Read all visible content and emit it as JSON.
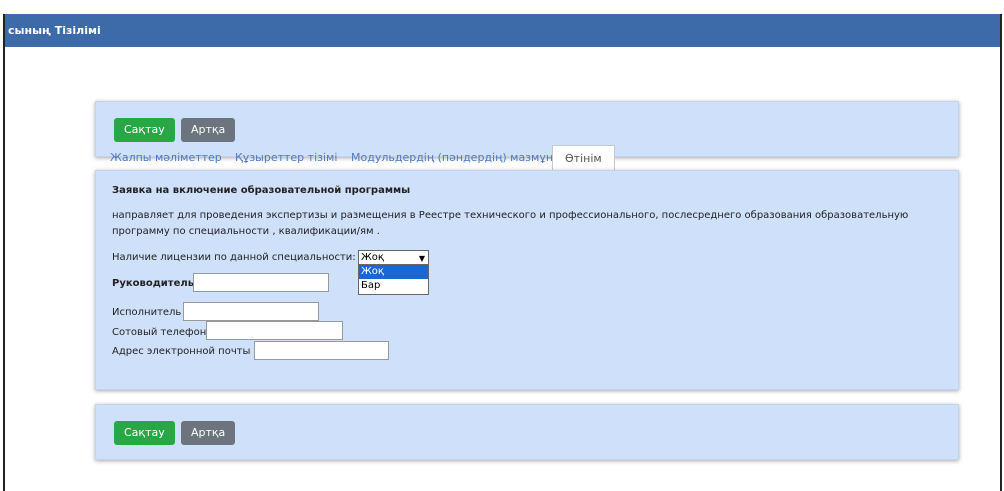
{
  "window": {
    "title": "сының Тізілімі"
  },
  "toolbar_top": {
    "save_label": "Сақтау",
    "back_label": "Артқа"
  },
  "toolbar_bottom": {
    "save_label": "Сақтау",
    "back_label": "Артқа"
  },
  "tabs": [
    {
      "label": "Жалпы мәліметтер"
    },
    {
      "label": "Құзыреттер тізімі"
    },
    {
      "label": "Модульдердің (пәндердің) мазмұны"
    },
    {
      "label": "Өтінім"
    }
  ],
  "form": {
    "heading": "Заявка на включение образовательной программы",
    "description_line1": "направляет для проведения экспертизы и размещения в Реестре технического и профессионального, послесреднего образования образовательную",
    "description_line2": "программу по специальности , квалификации/ям .",
    "license_label": "Наличие лицензии по данной специальности:",
    "license_value": "Жоқ",
    "license_options": [
      "Жоқ",
      "Бар"
    ],
    "manager_label": "Руководитель",
    "manager_value": "",
    "executor_label": "Исполнитель",
    "executor_value": "",
    "phone_label": "Сотовый телефон",
    "phone_value": "",
    "email_label": "Адрес электронной почты",
    "email_value": ""
  },
  "colors": {
    "titlebar": "#3d6aa8",
    "panel": "#cfe0fb",
    "save": "#28a745",
    "back": "#6c757d",
    "tab_link": "#4d7ac4",
    "selected_option": "#1a66d2"
  }
}
